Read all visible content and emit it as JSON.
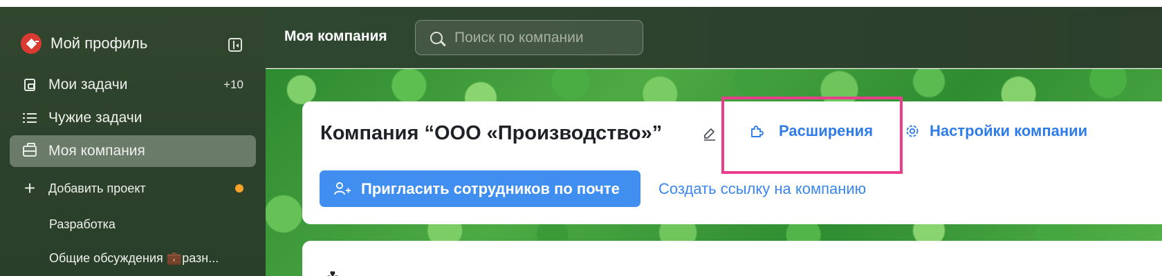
{
  "sidebar": {
    "profile_label": "Мой профиль",
    "items": [
      {
        "label": "Мои задачи",
        "badge": "+10",
        "icon": "tasks-icon"
      },
      {
        "label": "Чужие задачи",
        "icon": "list-icon"
      },
      {
        "label": "Моя компания",
        "icon": "briefcase-icon",
        "active": true
      },
      {
        "label": "Добавить проект",
        "icon": "plus-icon",
        "status_dot_color": "#f6a12a"
      }
    ],
    "projects": [
      "Разработка",
      "Общие обсуждения 💼разн..."
    ]
  },
  "topbar": {
    "title": "Моя компания",
    "search_placeholder": "Поиск по компании"
  },
  "company_card": {
    "title": "Компания “ООО «Производство»”",
    "tabs": [
      {
        "label": "Расширения",
        "icon": "puzzle-icon",
        "highlighted": true
      },
      {
        "label": "Настройки компании",
        "icon": "gear-icon"
      }
    ],
    "invite_button": "Пригласить сотрудников по почте",
    "create_link": "Создать ссылку на компанию"
  },
  "colors": {
    "accent": "#3f8ef0",
    "link": "#2f7ce8",
    "highlight": "#ea3d8c",
    "sidebar_bg": "#2f4530",
    "active_item": "#6b7b69",
    "avatar": "#d93a31"
  }
}
